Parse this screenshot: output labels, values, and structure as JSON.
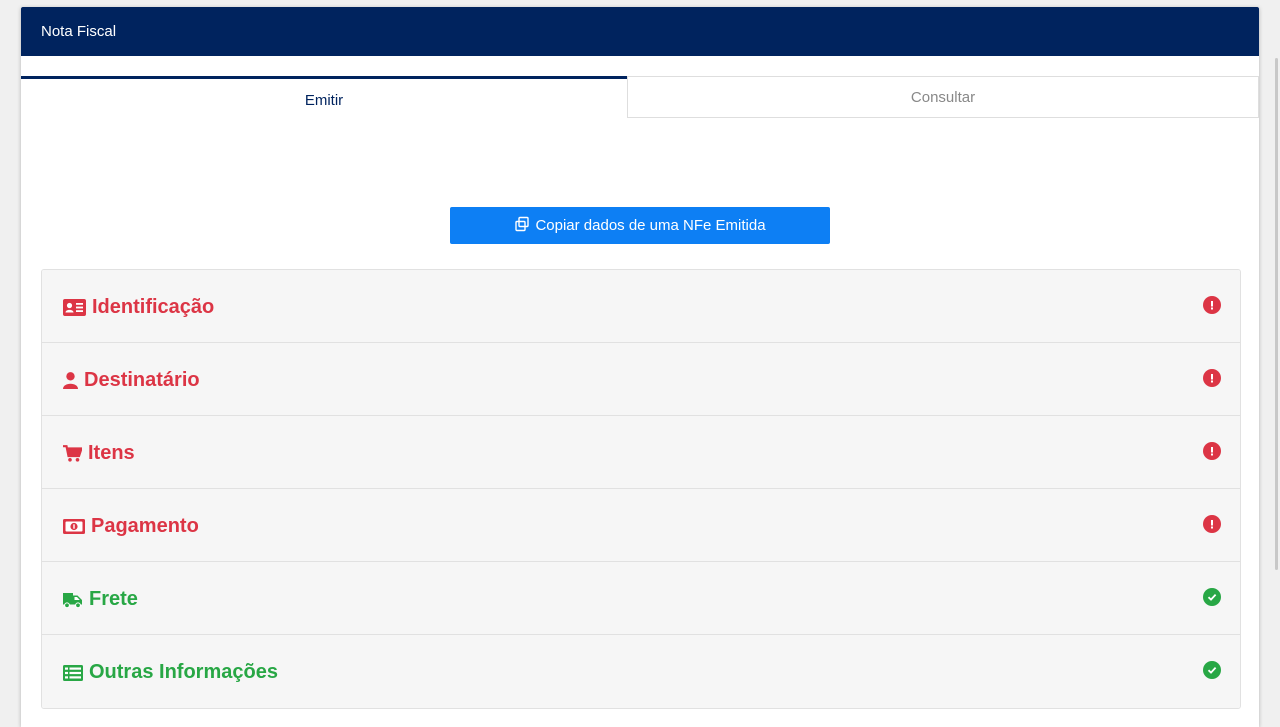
{
  "header": {
    "title": "Nota Fiscal"
  },
  "tabs": [
    {
      "label": "Emitir",
      "active": true
    },
    {
      "label": "Consultar",
      "active": false
    }
  ],
  "copy_button": {
    "label": "Copiar dados de uma NFe Emitida",
    "icon": "copy-icon"
  },
  "colors": {
    "header_bg": "#00235e",
    "button_bg": "#0d7ff4",
    "error": "#dc3545",
    "success": "#28a745"
  },
  "sections": [
    {
      "label": "Identificação",
      "icon": "id-card-icon",
      "status": "error"
    },
    {
      "label": "Destinatário",
      "icon": "user-icon",
      "status": "error"
    },
    {
      "label": "Itens",
      "icon": "cart-icon",
      "status": "error"
    },
    {
      "label": "Pagamento",
      "icon": "money-bill-icon",
      "status": "error"
    },
    {
      "label": "Frete",
      "icon": "truck-icon",
      "status": "ok"
    },
    {
      "label": "Outras Informações",
      "icon": "list-icon",
      "status": "ok"
    }
  ]
}
